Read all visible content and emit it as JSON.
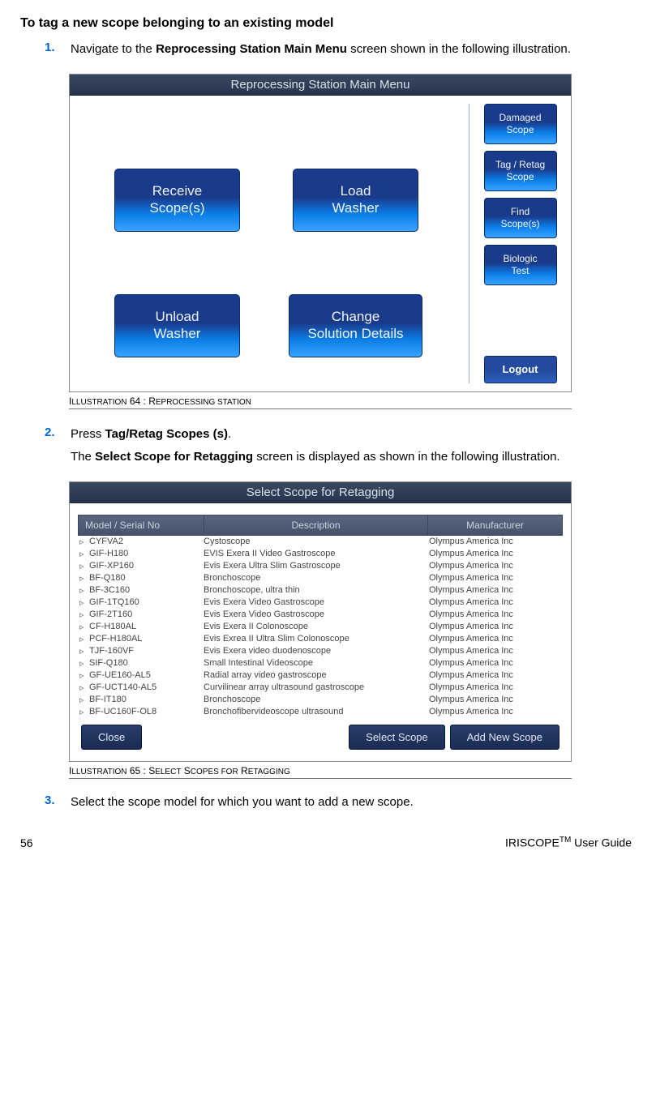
{
  "section_title": "To tag a new scope belonging to an existing model",
  "steps": {
    "s1": {
      "num": "1.",
      "pre": "Navigate to the ",
      "bold": "Reprocessing Station Main Menu",
      "post": " screen shown in the following illustration."
    },
    "s2": {
      "num": "2.",
      "pre": "Press ",
      "bold": "Tag/Retag Scopes (s)",
      "post": "."
    },
    "s2b": {
      "pre": "The ",
      "bold": "Select Scope for Retagging",
      "post": " screen is displayed as shown in the following illustration."
    },
    "s3": {
      "num": "3.",
      "text": "Select the scope model for which you want to add a new scope."
    }
  },
  "illus64": {
    "caption_pre": "I",
    "caption_sc": "LLUSTRATION",
    "caption_mid": " 64 : R",
    "caption_sc2": "EPROCESSING STATION",
    "titlebar": "Reprocessing Station Main Menu",
    "buttons": {
      "receive": "Receive\nScope(s)",
      "load": "Load\nWasher",
      "unload": "Unload\nWasher",
      "change": "Change\nSolution Details",
      "damaged": "Damaged\nScope",
      "tag": "Tag / Retag\nScope",
      "find": "Find\nScope(s)",
      "biologic": "Biologic\nTest",
      "logout": "Logout"
    }
  },
  "illus65": {
    "caption_pre": "I",
    "caption_sc": "LLUSTRATION",
    "caption_mid": " 65 : S",
    "caption_sc2": "ELECT",
    "caption_mid2": " S",
    "caption_sc3": "COPES FOR",
    "caption_mid3": " R",
    "caption_sc4": "ETAGGING",
    "titlebar": "Select Scope for Retagging",
    "headers": {
      "h1": "Model / Serial No",
      "h2": "Description",
      "h3": "Manufacturer"
    },
    "rows": [
      {
        "m": "CYFVA2",
        "d": "Cystoscope",
        "mf": "Olympus America Inc"
      },
      {
        "m": "GIF-H180",
        "d": "EVIS Exera II Video Gastroscope",
        "mf": "Olympus America Inc"
      },
      {
        "m": "GIF-XP160",
        "d": "Evis Exera Ultra Slim Gastroscope",
        "mf": "Olympus America Inc"
      },
      {
        "m": "BF-Q180",
        "d": "Bronchoscope",
        "mf": "Olympus America Inc"
      },
      {
        "m": "BF-3C160",
        "d": "Bronchoscope, ultra thin",
        "mf": "Olympus America Inc"
      },
      {
        "m": "GIF-1TQ160",
        "d": "Evis Exera Video Gastroscope",
        "mf": "Olympus America Inc"
      },
      {
        "m": "GIF-2T160",
        "d": "Evis Exera Video Gastroscope",
        "mf": "Olympus America Inc"
      },
      {
        "m": "CF-H180AL",
        "d": "Evis Exera II Colonoscope",
        "mf": "Olympus America Inc"
      },
      {
        "m": "PCF-H180AL",
        "d": "Evis Exrea II Ultra Slim Colonoscope",
        "mf": "Olympus America Inc"
      },
      {
        "m": "TJF-160VF",
        "d": "Evis Exera video duodenoscope",
        "mf": "Olympus America Inc"
      },
      {
        "m": "SIF-Q180",
        "d": "Small Intestinal Videoscope",
        "mf": "Olympus America Inc"
      },
      {
        "m": "GF-UE160-AL5",
        "d": "Radial array video gastroscope",
        "mf": "Olympus America Inc"
      },
      {
        "m": "GF-UCT140-AL5",
        "d": "Curvilinear array ultrasound gastroscope",
        "mf": "Olympus America Inc"
      },
      {
        "m": "BF-IT180",
        "d": "Bronchoscope",
        "mf": "Olympus America Inc"
      },
      {
        "m": "BF-UC160F-OL8",
        "d": "Bronchofibervideoscope  ultrasound",
        "mf": "Olympus America Inc"
      }
    ],
    "footer": {
      "close": "Close",
      "select": "Select Scope",
      "add": "Add New Scope"
    }
  },
  "page_footer": {
    "page": "56",
    "product": "IRISCOPE",
    "tm": "TM",
    "suffix": " User Guide"
  }
}
